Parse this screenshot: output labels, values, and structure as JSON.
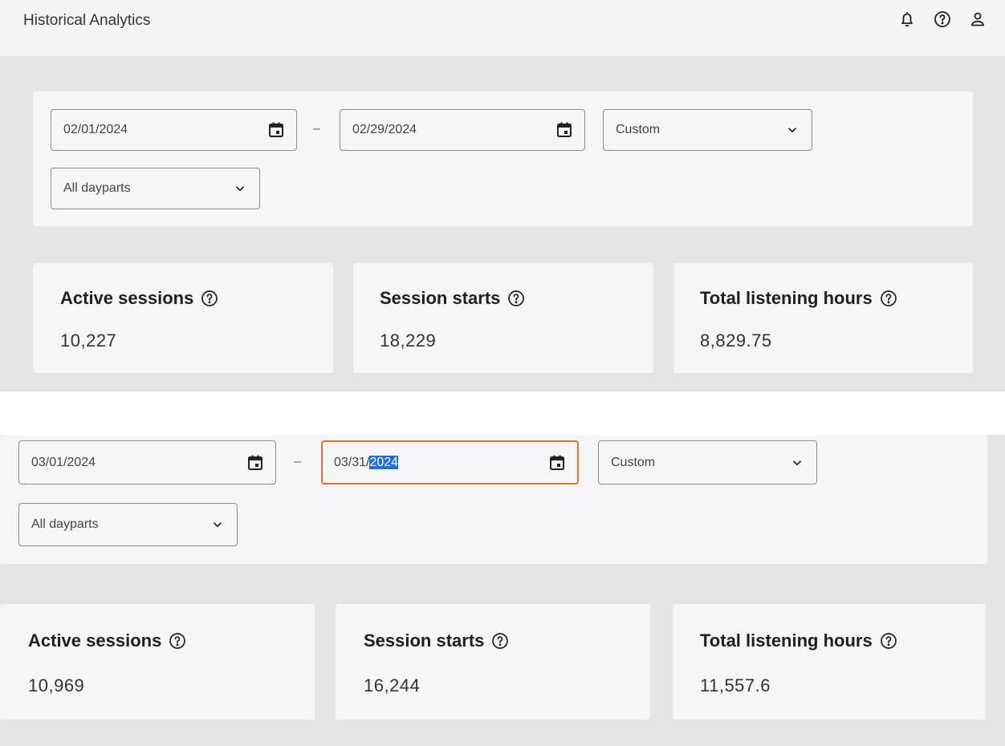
{
  "header": {
    "title": "Historical Analytics",
    "icons": [
      "bell-icon",
      "help-icon",
      "account-icon"
    ]
  },
  "snapshot_top": {
    "start_date": "02/01/2024",
    "end_date": "02/29/2024",
    "separator": "–",
    "range_preset": "Custom",
    "daypart": "All dayparts",
    "metrics": [
      {
        "label": "Active sessions",
        "value": "10,227"
      },
      {
        "label": "Session starts",
        "value": "18,229"
      },
      {
        "label": "Total listening hours",
        "value": "8,829.75"
      }
    ]
  },
  "snapshot_bottom": {
    "start_date": "03/01/2024",
    "end_date_prefix": "03/31/",
    "end_date_selected": "2024",
    "separator": "–",
    "range_preset": "Custom",
    "daypart": "All dayparts",
    "metrics": [
      {
        "label": "Active sessions",
        "value": "10,969"
      },
      {
        "label": "Session starts",
        "value": "16,244"
      },
      {
        "label": "Total listening hours",
        "value": "11,557.6"
      }
    ]
  },
  "colors": {
    "focus_border": "#e0702a",
    "selection": "#1f6fd4",
    "canvas": "#e6e4e8",
    "panel": "#f6f6f8"
  }
}
